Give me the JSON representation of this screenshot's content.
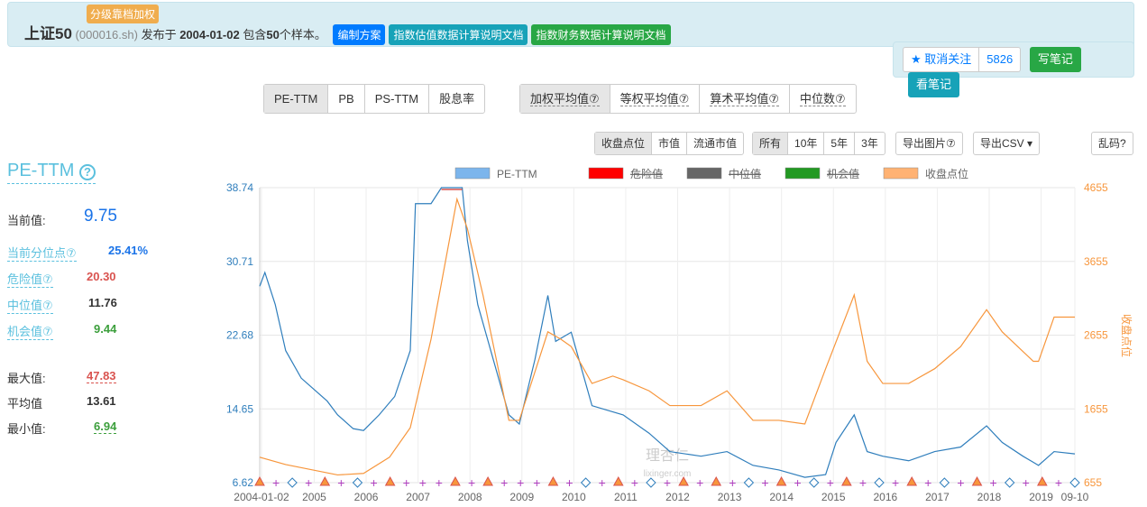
{
  "header": {
    "tag": "分级靠档加权",
    "name": "上证50",
    "code": "(000016.sh)",
    "published_prefix": "发布于",
    "date": "2004-01-02",
    "contains": "包含",
    "count": "50",
    "suffix": "个样本。",
    "buttons": [
      {
        "label": "编制方案",
        "color": "#007bff"
      },
      {
        "label": "指数估值数据计算说明文档",
        "color": "#17a2b8"
      },
      {
        "label": "指数财务数据计算说明文档",
        "color": "#28a745"
      }
    ]
  },
  "follow": {
    "unfollow": "★ 取消关注",
    "count": "5826",
    "write": "写笔记",
    "view": "看笔记"
  },
  "metric_tabs": [
    "PE-TTM",
    "PB",
    "PS-TTM",
    "股息率"
  ],
  "weight_tabs": [
    "加权平均值⑦",
    "等权平均值⑦",
    "算术平均值⑦",
    "中位数⑦"
  ],
  "overlay_tabs": [
    "收盘点位",
    "市值",
    "流通市值"
  ],
  "range_tabs": [
    "所有",
    "10年",
    "5年",
    "3年"
  ],
  "tools": {
    "export_img": "导出图片⑦",
    "export_csv": "导出CSV ▾",
    "garbled": "乱码?"
  },
  "stats": {
    "title": "PE-TTM",
    "help": "?",
    "current_label": "当前值:",
    "current": "9.75",
    "percentile_label": "当前分位点⑦",
    "percentile": "25.41%",
    "danger_label": "危险值⑦",
    "danger": "20.30",
    "median_label": "中位值⑦",
    "median": "11.76",
    "chance_label": "机会值⑦",
    "chance": "9.44",
    "max_label": "最大值:",
    "max": "47.83",
    "avg_label": "平均值",
    "avg": "13.61",
    "min_label": "最小值:",
    "min": "6.94"
  },
  "chart_data": {
    "type": "line",
    "legend": [
      {
        "name": "PE-TTM",
        "color": "#7cb5ec"
      },
      {
        "name": "危险值",
        "color": "#ff0000"
      },
      {
        "name": "中位值",
        "color": "#666666"
      },
      {
        "name": "机会值",
        "color": "#229922"
      },
      {
        "name": "收盘点位",
        "color": "#ffb273"
      }
    ],
    "x_ticks": [
      "2004-01-02",
      "2005",
      "2006",
      "2007",
      "2008",
      "2009",
      "2010",
      "2011",
      "2012",
      "2013",
      "2014",
      "2015",
      "2016",
      "2017",
      "2018",
      "2019",
      "09-10"
    ],
    "xlim": [
      2004.0,
      2019.7
    ],
    "y_left": {
      "ticks": [
        "38.74",
        "30.71",
        "22.68",
        "14.65",
        "6.62"
      ],
      "lim": [
        6.62,
        38.74
      ]
    },
    "y_right": {
      "label": "收盘点位",
      "ticks": [
        "4655",
        "3655",
        "2655",
        "1655",
        "655"
      ],
      "lim": [
        655,
        4655
      ]
    },
    "watermark": "理杏仁 lixinger.com",
    "series": [
      {
        "name": "PE-TTM",
        "color": "#2f7ebc",
        "x": [
          2004.0,
          2004.1,
          2004.3,
          2004.5,
          2004.8,
          2005.0,
          2005.3,
          2005.5,
          2005.8,
          2006.0,
          2006.3,
          2006.6,
          2006.9,
          2007.0,
          2007.3,
          2007.5,
          2007.9,
          2008.0,
          2008.2,
          2008.5,
          2008.8,
          2009.0,
          2009.3,
          2009.55,
          2009.7,
          2010.0,
          2010.4,
          2010.7,
          2011.0,
          2011.5,
          2011.9,
          2012.5,
          2013.0,
          2013.5,
          2014.0,
          2014.5,
          2014.9,
          2015.1,
          2015.45,
          2015.7,
          2016.0,
          2016.5,
          2017.0,
          2017.5,
          2018.0,
          2018.3,
          2018.7,
          2019.0,
          2019.3,
          2019.7
        ],
        "y": [
          28,
          29.5,
          26,
          21,
          18,
          17,
          15.5,
          14,
          12.5,
          12.3,
          14,
          16,
          21,
          37,
          37,
          38.74,
          38.74,
          33,
          26,
          20,
          14,
          13,
          20,
          27,
          22,
          23,
          15,
          14.5,
          14,
          12,
          10,
          9.5,
          10,
          8.5,
          8,
          7.2,
          7.5,
          11,
          14,
          10,
          9.5,
          9,
          10,
          10.5,
          12.8,
          11,
          9.5,
          8.5,
          10,
          9.75
        ]
      },
      {
        "name": "收盘点位",
        "color": "#f7963c",
        "axis": "right",
        "x": [
          2004.0,
          2004.5,
          2005.5,
          2006.0,
          2006.5,
          2006.9,
          2007.3,
          2007.8,
          2008.0,
          2008.3,
          2008.8,
          2009.0,
          2009.55,
          2009.8,
          2010.0,
          2010.4,
          2010.8,
          2011.0,
          2011.5,
          2011.9,
          2012.5,
          2013.0,
          2013.5,
          2014.0,
          2014.5,
          2014.9,
          2015.45,
          2015.7,
          2016.0,
          2016.5,
          2017.0,
          2017.5,
          2018.0,
          2018.3,
          2018.9,
          2019.0,
          2019.3,
          2019.7
        ],
        "y": [
          1000,
          900,
          760,
          780,
          1000,
          1400,
          2600,
          4500,
          4100,
          3200,
          1500,
          1500,
          2700,
          2600,
          2500,
          2000,
          2100,
          2050,
          1900,
          1700,
          1700,
          1900,
          1500,
          1500,
          1450,
          2200,
          3200,
          2300,
          2000,
          2000,
          2200,
          2500,
          3000,
          2700,
          2300,
          2300,
          2900,
          2900
        ]
      }
    ]
  }
}
